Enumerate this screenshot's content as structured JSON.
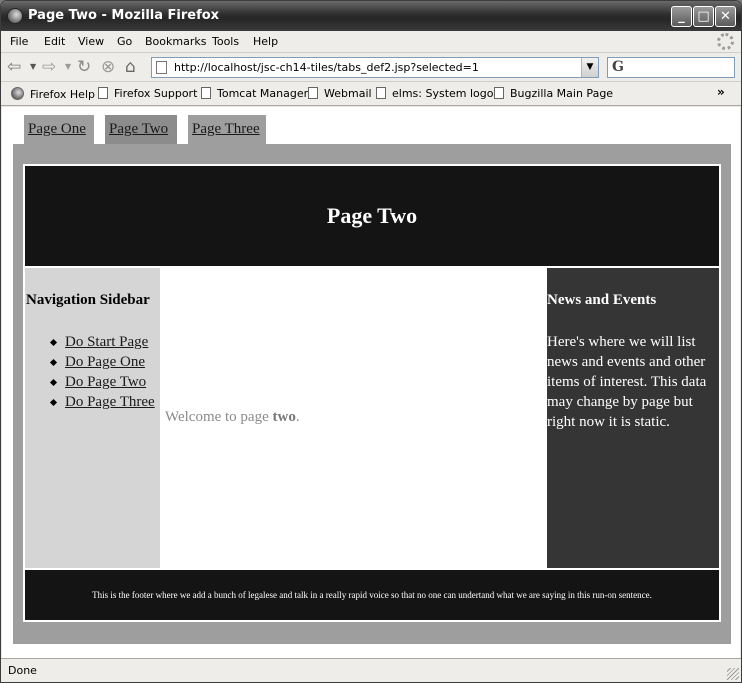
{
  "window": {
    "title": "Page Two - Mozilla Firefox"
  },
  "menu": [
    "File",
    "Edit",
    "View",
    "Go",
    "Bookmarks",
    "Tools",
    "Help"
  ],
  "navbar": {
    "url": "http://localhost/jsc-ch14-tiles/tabs_def2.jsp?selected=1",
    "search_engine_glyph": "G"
  },
  "bookmarks": [
    "Firefox Help",
    "Firefox Support",
    "Tomcat Manager",
    "Webmail",
    "elms: System logon",
    "Bugzilla Main Page"
  ],
  "bookmarks_overflow": "»",
  "page": {
    "tabs": [
      {
        "label": "Page One",
        "selected": false
      },
      {
        "label": "Page Two",
        "selected": true
      },
      {
        "label": "Page Three",
        "selected": false
      }
    ],
    "header": "Page Two",
    "sidebar": {
      "title": "Navigation Sidebar",
      "links": [
        "Do Start Page",
        "Do Page One",
        "Do Page Two",
        "Do Page Three"
      ]
    },
    "main": {
      "welcome_prefix": "Welcome to page ",
      "welcome_bold": "two",
      "welcome_suffix": "."
    },
    "news": {
      "title": "News and Events",
      "text": "Here's where we will list news and events and other items of interest. This data may change by page but right now it is static."
    },
    "footer": "This is the footer where we add a bunch of legalese and talk in a really rapid voice so that no one can undertand what we are saying in this run-on sentence."
  },
  "status": "Done",
  "colors": {
    "header_bg": "#141414",
    "sidebar_bg": "#d5d5d5",
    "news_bg": "#353535",
    "tab_bg": "#9e9e9e"
  }
}
